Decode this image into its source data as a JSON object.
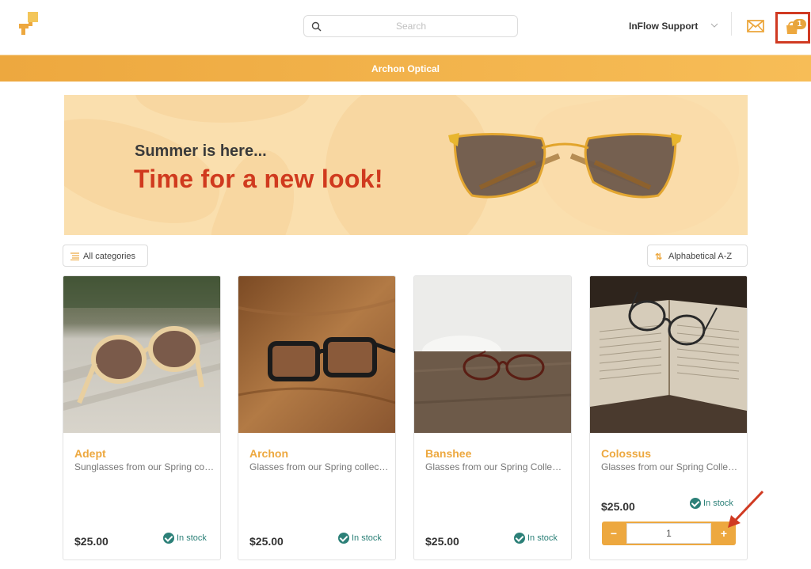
{
  "header": {
    "logo_icon": "inflow-logo-icon",
    "search": {
      "placeholder": "Search",
      "value": ""
    },
    "user_name": "InFlow Support",
    "mail_icon": "envelope-icon",
    "cart": {
      "icon": "shopping-bag-icon",
      "count": "1"
    }
  },
  "store": {
    "name": "Archon Optical"
  },
  "banner": {
    "line1": "Summer is here...",
    "line2": "Time for a new look!"
  },
  "toolbar": {
    "category_filter": "All categories",
    "sort": "Alphabetical A-Z"
  },
  "products": [
    {
      "name": "Adept",
      "description": "Sunglasses from our Spring collection",
      "price": "$25.00",
      "stock": "In stock"
    },
    {
      "name": "Archon",
      "description": "Glasses from our Spring collection",
      "price": "$25.00",
      "stock": "In stock"
    },
    {
      "name": "Banshee",
      "description": "Glasses from our Spring Collection",
      "price": "$25.00",
      "stock": "In stock"
    },
    {
      "name": "Colossus",
      "description": "Glasses from our Spring Collection",
      "price": "$25.00",
      "stock": "In stock",
      "quantity": "1",
      "minus": "−",
      "plus": "+"
    }
  ],
  "colors": {
    "accent": "#eda83f",
    "stock": "#2c8078",
    "highlight": "#d03a22",
    "banner_red": "#d03a1e"
  }
}
